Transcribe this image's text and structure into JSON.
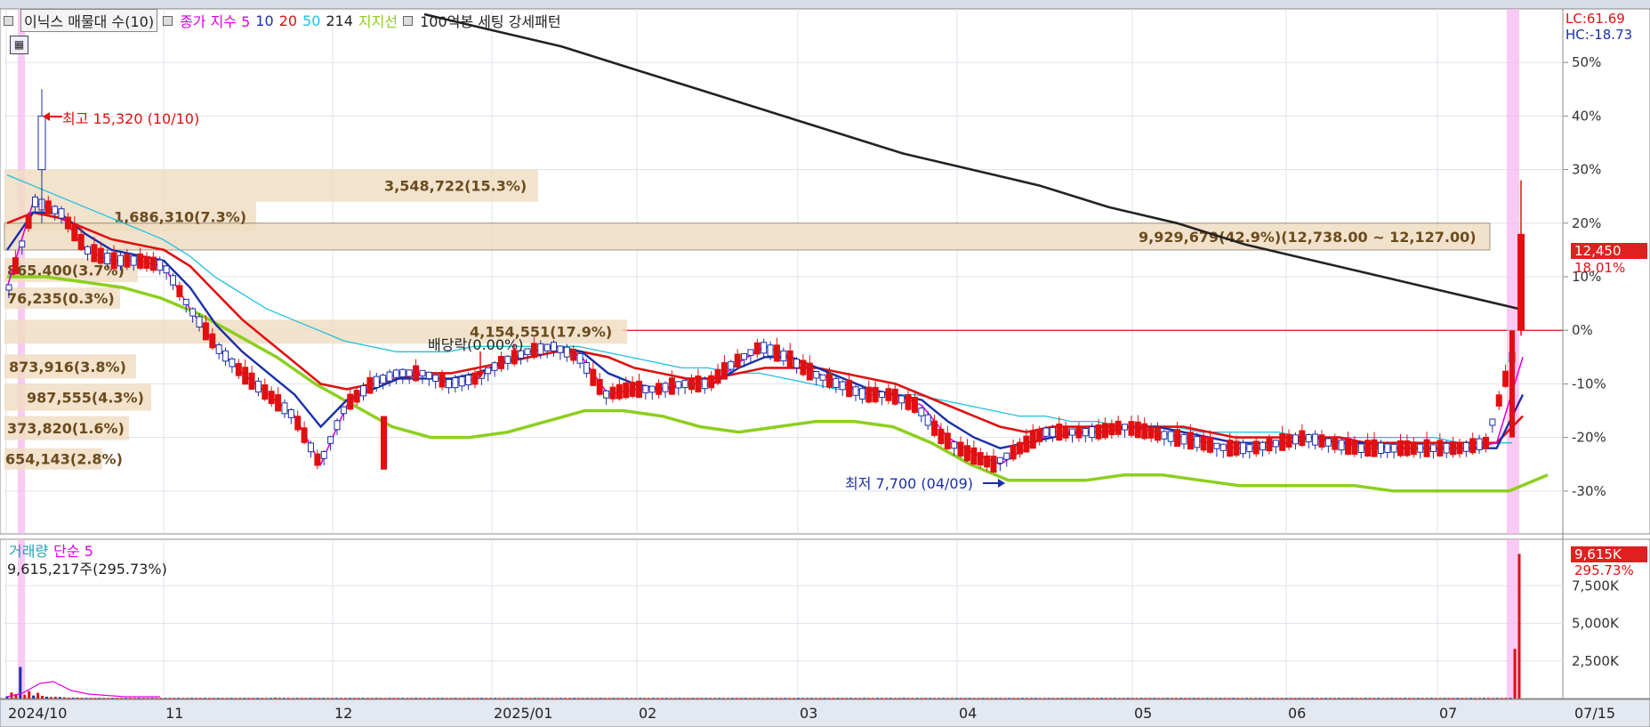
{
  "legend": {
    "title": "이닉스 매물대 수(10)",
    "ma_label": "종가 지수 5",
    "ma_periods": [
      "10",
      "20",
      "50",
      "214"
    ],
    "support_label": "지지선",
    "pattern_label": "100억봉 세팅 강세패턴",
    "colors": {
      "ma5": "#e000e0",
      "ma10": "#1a2fa8",
      "ma20": "#e01010",
      "ma50": "#20c0e0",
      "ma214": "#222222",
      "support": "#8ccf1e"
    }
  },
  "right_top": {
    "lc": "LC:61.69",
    "hc": "HC:-18.73"
  },
  "price_tag": {
    "value": "12,450",
    "change": "18.01%"
  },
  "annotations": {
    "high": "최고 15,320 (10/10)",
    "low": "최저 7,700 (04/09)",
    "dividend": "배당락(0.00%)"
  },
  "volume": {
    "legend_label": "거래량",
    "ma_label": "단순 5",
    "info": "9,615,217주(295.73%)",
    "tag_value": "9,615K",
    "tag_pct": "295.73%"
  },
  "icons": {
    "calc": "calculator-icon"
  },
  "chart_data": [
    {
      "type": "candlestick",
      "title": "이닉스 매물대 수(10)",
      "y_axis_ticks": [
        "50%",
        "40%",
        "30%",
        "20%",
        "10%",
        "0%",
        "-10%",
        "-20%",
        "-30%"
      ],
      "y_range_pct": [
        -38,
        60
      ],
      "x_tick_labels": [
        "2024/10",
        "11",
        "12",
        "2025/01",
        "02",
        "03",
        "04",
        "05",
        "06",
        "07",
        "07/15"
      ],
      "volume_profile": [
        {
          "label": "3,548,722(15.3%)",
          "pct_top": 30,
          "pct_bottom": 24
        },
        {
          "label": "1,686,310(7.3%)",
          "pct_top": 24,
          "pct_bottom": 18.5
        },
        {
          "label": "9,929,679(42.9%)(12,738.00 ~ 12,127.00)",
          "pct_top": 20,
          "pct_bottom": 15
        },
        {
          "label": "865,400(3.7%)",
          "pct_top": 13.5,
          "pct_bottom": 9
        },
        {
          "label": "76,235(0.3%)",
          "pct_top": 8,
          "pct_bottom": 4
        },
        {
          "label": "4,154,551(17.9%)",
          "pct_top": 2,
          "pct_bottom": -2.5
        },
        {
          "label": "873,916(3.8%)",
          "pct_top": -4.5,
          "pct_bottom": -9
        },
        {
          "label": "987,555(4.3%)",
          "pct_top": -10,
          "pct_bottom": -15
        },
        {
          "label": "373,820(1.6%)",
          "pct_top": -16,
          "pct_bottom": -20.5
        },
        {
          "label": "654,143(2.8%)",
          "pct_top": -22,
          "pct_bottom": -26
        }
      ],
      "series": [
        {
          "name": "5",
          "color": "#e000e0",
          "values": [
            8,
            24,
            22,
            15,
            13,
            13,
            12,
            4,
            -3,
            -8,
            -12,
            -16,
            -25,
            -14,
            -10,
            -8,
            -8,
            -10,
            -9,
            -6,
            -4,
            -3,
            -5,
            -12,
            -11,
            -11,
            -10,
            -10,
            -6,
            -3,
            -5,
            -8,
            -10,
            -12,
            -12,
            -14,
            -20,
            -23,
            -25,
            -22,
            -19,
            -19,
            -19,
            -18,
            -19,
            -20,
            -21,
            -22,
            -22,
            -21,
            -20,
            -21,
            -22,
            -22,
            -22,
            -22,
            -22,
            -21,
            -5
          ]
        },
        {
          "name": "10",
          "color": "#1a2fa8",
          "values": [
            15,
            22,
            22,
            18,
            15,
            14,
            13,
            8,
            1,
            -4,
            -8,
            -12,
            -18,
            -13,
            -11,
            -9,
            -9,
            -9,
            -8,
            -6,
            -4,
            -3,
            -4,
            -8,
            -10,
            -11,
            -10,
            -10,
            -7,
            -5,
            -5,
            -7,
            -9,
            -11,
            -12,
            -13,
            -17,
            -20,
            -22,
            -21,
            -20,
            -19,
            -19,
            -18,
            -18,
            -19,
            -20,
            -21,
            -21,
            -21,
            -20,
            -21,
            -21,
            -22,
            -22,
            -22,
            -22,
            -22,
            -12
          ]
        },
        {
          "name": "20",
          "color": "#e01010",
          "values": [
            20,
            22,
            21,
            19,
            17,
            16,
            15,
            12,
            7,
            2,
            -2,
            -6,
            -10,
            -11,
            -10,
            -9,
            -8,
            -8,
            -7,
            -6,
            -5,
            -4,
            -4,
            -5,
            -7,
            -8,
            -9,
            -9,
            -8,
            -7,
            -7,
            -7,
            -8,
            -9,
            -10,
            -12,
            -14,
            -16,
            -18,
            -19,
            -18,
            -18,
            -18,
            -18,
            -18,
            -18,
            -19,
            -20,
            -20,
            -20,
            -20,
            -20,
            -21,
            -21,
            -21,
            -21,
            -21,
            -21,
            -16
          ]
        },
        {
          "name": "50",
          "color": "#20c0e0",
          "values": [
            29,
            27,
            25,
            23,
            21,
            19,
            17,
            14,
            10,
            7,
            4,
            2,
            0,
            -2,
            -3,
            -4,
            -4,
            -4,
            -3,
            -3,
            -3,
            -3,
            -3,
            -4,
            -5,
            -6,
            -7,
            -7,
            -8,
            -8,
            -9,
            -10,
            -11,
            -11,
            -12,
            -12,
            -13,
            -14,
            -15,
            -16,
            -16,
            -17,
            -17,
            -18,
            -18,
            -18,
            -19,
            -19,
            -19,
            -19,
            -20,
            -20,
            -20,
            -20,
            -20,
            -20,
            -21,
            -21,
            -21
          ]
        },
        {
          "name": "214",
          "color": "#222222",
          "values_note": "declining line",
          "values": [
            59,
            56,
            53,
            49,
            45,
            41,
            37,
            33,
            30,
            27,
            23,
            20,
            16,
            13,
            10,
            7,
            4
          ]
        },
        {
          "name": "지지선",
          "color": "#8ccf1e",
          "values": [
            10,
            10,
            9,
            8,
            6,
            3,
            -1,
            -5,
            -10,
            -14,
            -18,
            -20,
            -20,
            -19,
            -17,
            -15,
            -15,
            -16,
            -18,
            -19,
            -18,
            -17,
            -17,
            -18,
            -21,
            -25,
            -28,
            -28,
            -28,
            -27,
            -27,
            -28,
            -29,
            -29,
            -29,
            -29,
            -30,
            -30,
            -30,
            -30,
            -27
          ]
        }
      ],
      "last_close": 12450,
      "last_change_pct": 18.01
    },
    {
      "type": "bar",
      "title": "거래량",
      "y_axis_ticks": [
        "7,500K",
        "5,000K",
        "2,500K"
      ],
      "y_range": [
        0,
        10000
      ],
      "unit": "K",
      "values_k": [
        150,
        400,
        300,
        2100,
        250,
        500,
        200,
        380,
        180,
        120,
        100,
        120,
        100,
        80,
        60,
        60,
        60,
        50,
        40,
        40,
        40,
        40,
        40,
        40,
        40,
        40,
        40,
        40,
        40,
        40,
        40,
        40,
        40,
        40,
        40,
        40,
        40,
        40,
        40,
        40,
        40,
        40,
        40,
        40,
        40,
        40,
        40,
        40,
        40,
        40,
        40,
        40,
        40,
        40,
        40,
        40,
        40,
        40,
        40,
        40,
        40,
        60,
        50,
        40,
        40,
        40,
        40,
        40,
        40,
        40,
        40,
        40,
        40,
        40,
        40,
        40,
        40,
        40,
        40,
        40,
        40,
        40,
        40,
        40,
        40,
        40,
        40,
        40,
        40,
        40,
        40,
        40,
        40,
        40,
        40,
        40,
        40,
        40,
        40,
        40,
        40,
        40,
        40,
        40,
        40,
        40,
        40,
        40,
        40,
        40,
        40,
        40,
        40,
        40,
        40,
        40,
        40,
        40,
        40,
        40,
        40,
        40,
        40,
        40,
        40,
        40,
        40,
        40,
        40,
        40,
        40,
        40,
        40,
        40,
        40,
        40,
        40,
        40,
        40,
        40,
        40,
        40,
        40,
        40,
        40,
        40,
        40,
        40,
        40,
        40,
        40,
        40,
        40,
        40,
        40,
        40,
        40,
        40,
        40,
        40,
        40,
        40,
        40,
        40,
        40,
        40,
        40,
        40,
        40,
        40,
        40,
        40,
        40,
        40,
        40,
        40,
        40,
        40,
        40,
        40,
        40,
        40,
        40,
        40,
        40,
        40,
        40,
        40,
        40,
        40,
        40,
        40,
        40,
        40,
        40,
        40,
        40,
        40,
        40,
        40,
        40,
        40,
        40,
        40,
        40,
        40,
        40,
        40,
        40,
        40,
        40,
        40,
        40,
        40,
        40,
        40,
        40,
        40,
        40,
        40,
        40,
        40,
        40,
        40,
        40,
        40,
        40,
        40,
        40,
        40,
        40,
        40,
        40,
        40,
        40,
        40,
        40,
        40,
        40,
        40,
        40,
        40,
        40,
        40,
        40,
        40,
        40,
        40,
        40,
        40,
        40,
        40,
        40,
        40,
        40,
        40,
        40,
        40,
        40,
        40,
        40,
        40,
        40,
        40,
        40,
        40,
        40,
        40,
        40,
        40,
        40,
        40,
        40,
        40,
        40,
        40,
        40,
        40,
        40,
        40,
        40,
        40,
        40,
        40,
        40,
        40,
        40,
        40,
        40,
        40,
        40,
        40,
        40,
        40,
        40,
        40,
        40,
        40,
        40,
        40,
        40,
        40,
        40,
        40,
        40,
        40,
        40,
        40,
        40,
        40,
        40,
        40,
        40,
        40,
        40,
        40,
        40,
        40,
        40,
        40,
        40,
        40,
        40,
        40,
        40,
        40,
        40,
        40,
        40,
        40,
        40,
        40,
        40,
        40,
        40,
        40,
        40,
        40,
        40,
        40,
        40,
        40,
        40,
        3300,
        9615
      ]
    }
  ]
}
